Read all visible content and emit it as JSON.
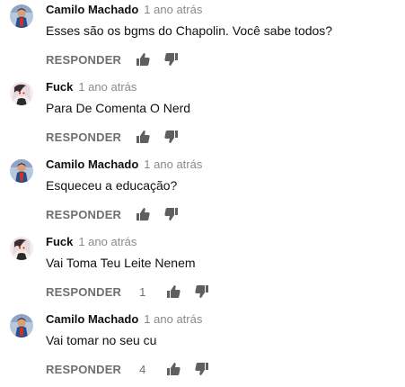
{
  "labels": {
    "reply": "RESPONDER"
  },
  "colors": {
    "author": "#0f0f0f",
    "meta": "#8a8a8a",
    "action": "#6f6f6f"
  },
  "comments": [
    {
      "author": "Camilo Machado",
      "time": "1 ano atrás",
      "text": "Esses são os bgms do Chapolin. Você sabe todos?",
      "likes": "",
      "avatar": "camilo-avatar"
    },
    {
      "author": "Fuck",
      "time": "1 ano atrás",
      "text": "Para De Comenta O Nerd",
      "likes": "",
      "avatar": "fuck-avatar"
    },
    {
      "author": "Camilo Machado",
      "time": "1 ano atrás",
      "text": "Esqueceu a educação?",
      "likes": "",
      "avatar": "camilo-avatar"
    },
    {
      "author": "Fuck",
      "time": "1 ano atrás",
      "text": "Vai Toma Teu Leite Nenem",
      "likes": "1",
      "avatar": "fuck-avatar"
    },
    {
      "author": "Camilo Machado",
      "time": "1 ano atrás",
      "text": "Vai tomar no seu cu",
      "likes": "4",
      "avatar": "camilo-avatar"
    }
  ]
}
